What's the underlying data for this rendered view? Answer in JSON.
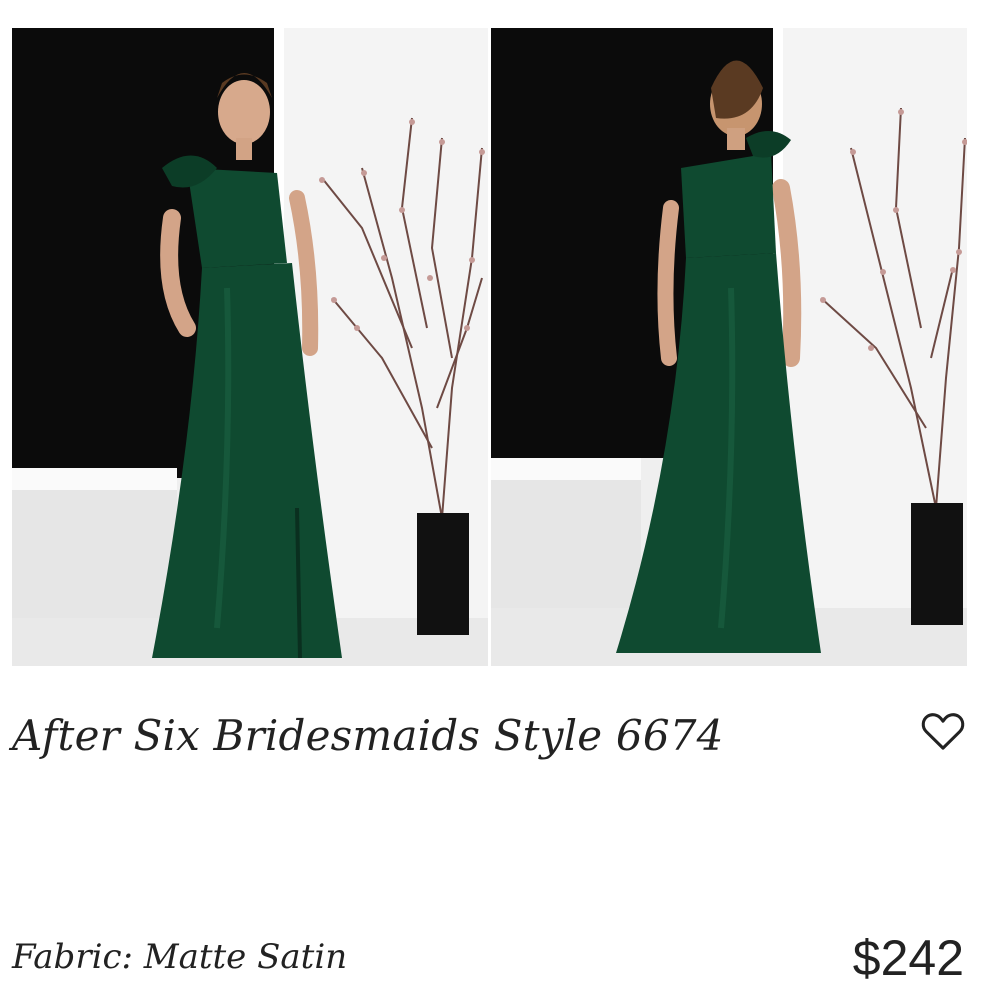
{
  "product": {
    "title": "After Six Bridesmaids Style 6674",
    "fabric_label": "Fabric: Matte Satin",
    "price": "$242"
  },
  "images": [
    {
      "view": "front",
      "icon": "dress-front-photo"
    },
    {
      "view": "back",
      "icon": "dress-back-photo"
    }
  ],
  "icons": {
    "favorite": "heart-icon"
  },
  "colors": {
    "dress": "#0f4a30",
    "wall_dark": "#0b0b0b",
    "wall_light": "#f0f0f0",
    "text": "#222222"
  }
}
